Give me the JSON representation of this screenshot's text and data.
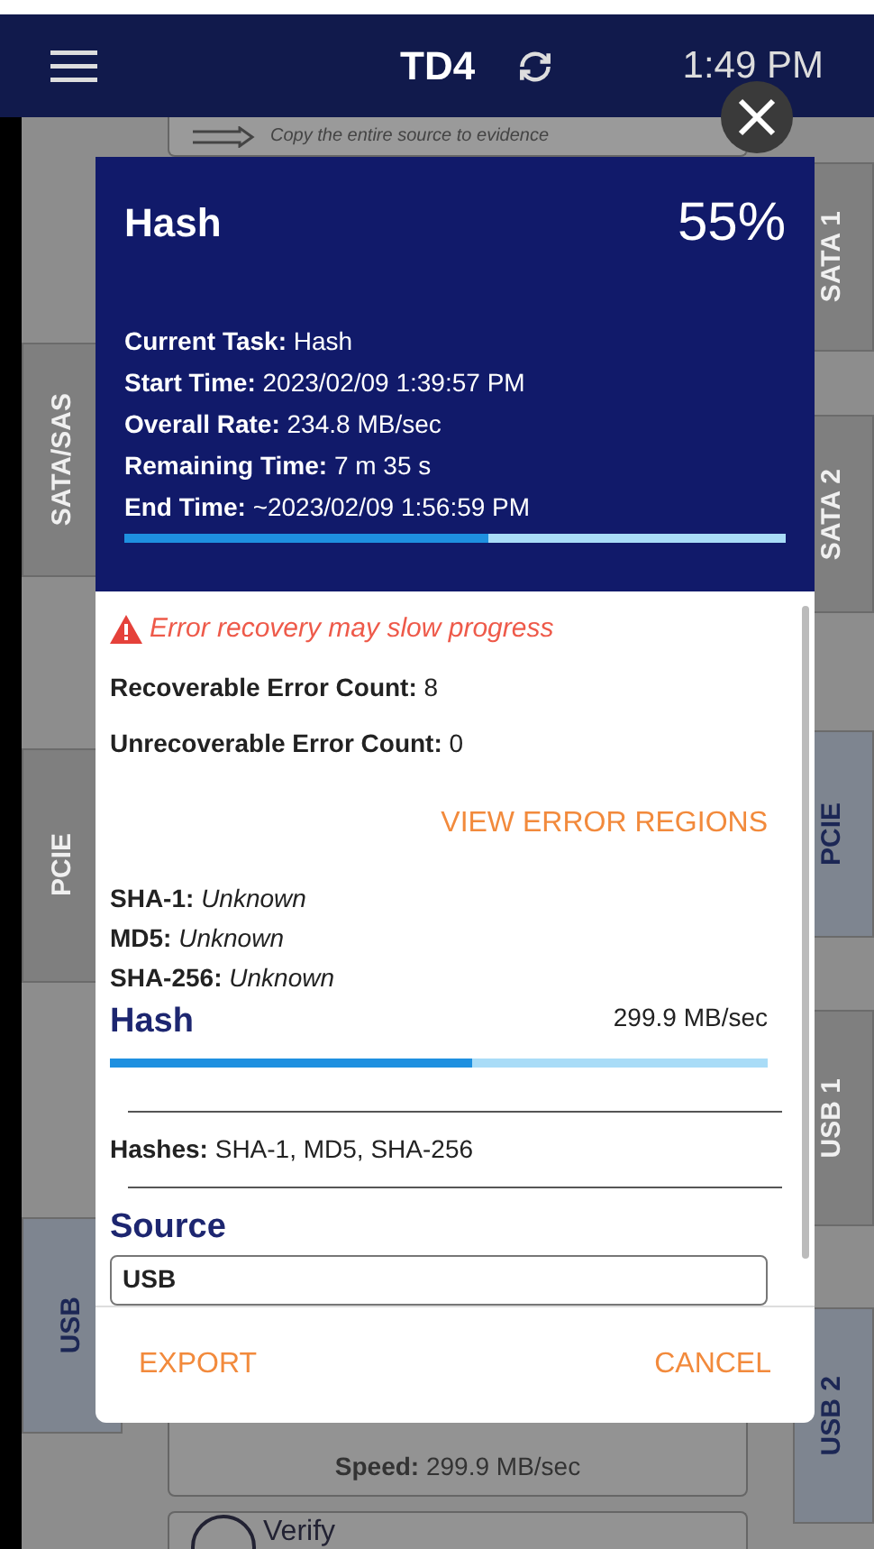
{
  "header": {
    "title": "TD4",
    "time": "1:49 PM"
  },
  "background": {
    "left_tabs": [
      {
        "label": "SATA/SAS",
        "active": false
      },
      {
        "label": "PCIE",
        "active": false
      },
      {
        "label": "USB",
        "active": true
      }
    ],
    "right_tabs": [
      {
        "label": "SATA 1",
        "active": false
      },
      {
        "label": "SATA 2",
        "active": false
      },
      {
        "label": "PCIE",
        "active": true
      },
      {
        "label": "USB 1",
        "active": false
      },
      {
        "label": "USB 2",
        "active": true
      }
    ],
    "top_card": "Copy the entire source to evidence",
    "speed_card": "**Speed:** 299.9 MB/sec",
    "verify_card": "Verify"
  },
  "dialog": {
    "title": "Hash",
    "percent": "55%",
    "level": 0.55,
    "info": [
      {
        "label": "Current Task:",
        "value": "Hash"
      },
      {
        "label": "Start Time:",
        "value": "2023/02/09 1:39:57 PM"
      },
      {
        "label": "Overall Rate:",
        "value": "234.8 MB/sec"
      },
      {
        "label": "Remaining Time:",
        "value": "7 m 35 s"
      },
      {
        "label": "End Time:",
        "value": "~2023/02/09 1:56:59 PM"
      }
    ],
    "warning": "Error recovery may slow progress",
    "counts": [
      {
        "label": "Recoverable Error Count:",
        "value": "8"
      },
      {
        "label": "Unrecoverable Error Count:",
        "value": "0"
      }
    ],
    "link": "VIEW ERROR REGIONS",
    "hashes": [
      {
        "label": "SHA-1:",
        "value": "Unknown"
      },
      {
        "label": "MD5:",
        "value": "Unknown"
      },
      {
        "label": "SHA-256:",
        "value": "Unknown"
      }
    ],
    "task": {
      "title": "Hash",
      "rate": "299.9 MB/sec",
      "level": 0.55
    },
    "hash_list": {
      "label": "Hashes:",
      "value": "SHA-1, MD5, SHA-256"
    },
    "source": {
      "title": "Source",
      "value": "USB"
    },
    "buttons": [
      "EXPORT",
      "CANCEL"
    ]
  }
}
